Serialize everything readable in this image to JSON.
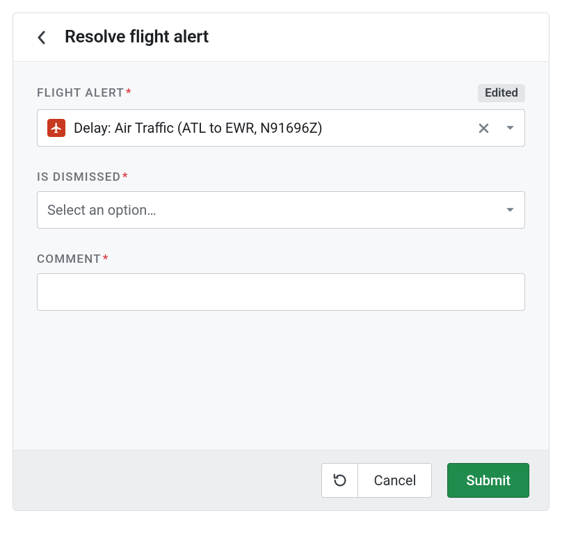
{
  "header": {
    "title": "Resolve flight alert"
  },
  "fields": {
    "flight_alert": {
      "label": "FLIGHT ALERT",
      "badge": "Edited",
      "value": "Delay: Air Traffic (ATL to EWR, N91696Z)"
    },
    "is_dismissed": {
      "label": "IS DISMISSED",
      "placeholder": "Select an option…"
    },
    "comment": {
      "label": "COMMENT",
      "value": ""
    }
  },
  "footer": {
    "cancel": "Cancel",
    "submit": "Submit"
  }
}
